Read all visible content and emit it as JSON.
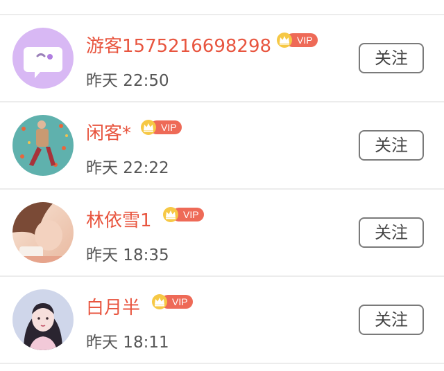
{
  "follow_list": {
    "items": [
      {
        "name": "游客1575216698298",
        "badge": "VIP",
        "time": "昨天 22:50",
        "follow_label": "关注",
        "avatar_icon": "chat-bubble-icon",
        "avatar_bg": "#d8b8f4"
      },
      {
        "name": "闲客*",
        "badge": "VIP",
        "time": "昨天 22:22",
        "follow_label": "关注",
        "avatar_icon": "user-photo"
      },
      {
        "name": "林依雪1",
        "badge": "VIP",
        "time": "昨天 18:35",
        "follow_label": "关注",
        "avatar_icon": "user-photo"
      },
      {
        "name": "白月半",
        "badge": "VIP",
        "time": "昨天 18:11",
        "follow_label": "关注",
        "avatar_icon": "user-photo"
      }
    ]
  },
  "colors": {
    "name": "#e8553f",
    "vip_tag": "#ee6a57",
    "crown": "#f4b400",
    "button_border": "#7a7a7a"
  }
}
